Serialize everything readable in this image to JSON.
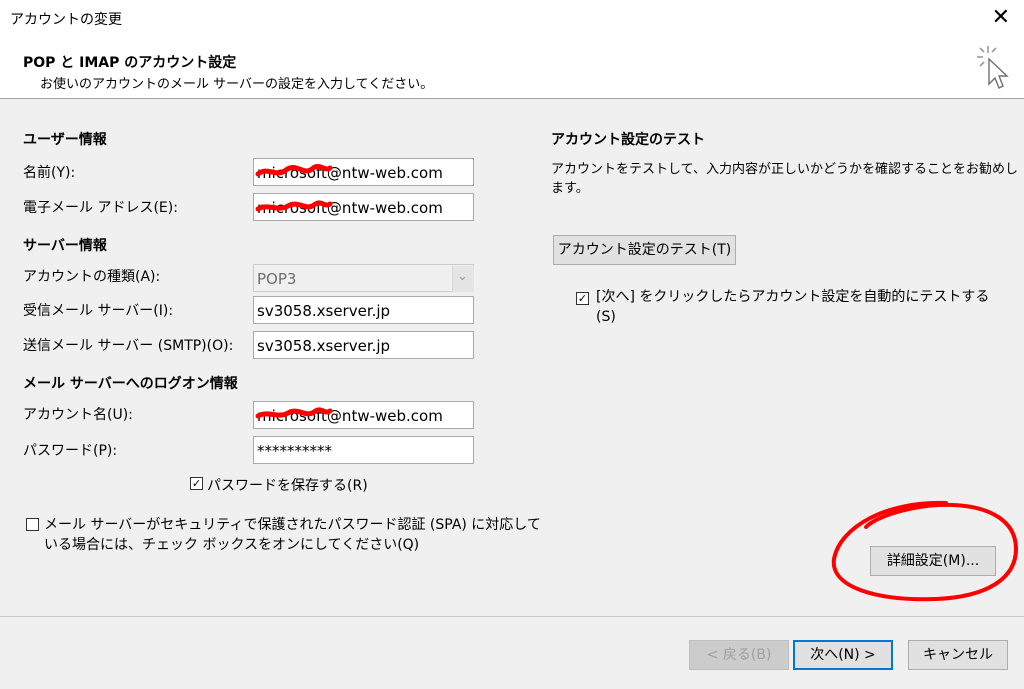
{
  "dialog": {
    "title": "アカウントの変更",
    "close_glyph": "✕",
    "header_title": "POP と IMAP のアカウント設定",
    "header_subtitle": "お使いのアカウントのメール サーバーの設定を入力してください。",
    "header_icon": "wizard-cursor-icon"
  },
  "user_info": {
    "heading": "ユーザー情報",
    "name_label": "名前(Y):",
    "name_value": "microsoft@ntw-web.com",
    "email_label": "電子メール アドレス(E):",
    "email_value": "microsoft@ntw-web.com"
  },
  "server_info": {
    "heading": "サーバー情報",
    "account_type_label": "アカウントの種類(A):",
    "account_type_value": "POP3",
    "incoming_label": "受信メール サーバー(I):",
    "incoming_value": "sv3058.xserver.jp",
    "outgoing_label": "送信メール サーバー (SMTP)(O):",
    "outgoing_value": "sv3058.xserver.jp"
  },
  "logon_info": {
    "heading": "メール サーバーへのログオン情報",
    "account_name_label": "アカウント名(U):",
    "account_name_value": "microsoft@ntw-web.com",
    "password_label": "パスワード(P):",
    "password_value": "**********",
    "save_password_label": "パスワードを保存する(R)",
    "save_password_checked": true,
    "spa_label_line1": "メール サーバーがセキュリティで保護されたパスワード認証 (SPA) に対応して",
    "spa_label_line2": "いる場合には、チェック ボックスをオンにしてください(Q)",
    "spa_checked": false
  },
  "test": {
    "heading": "アカウント設定のテスト",
    "desc_line1": "アカウントをテストして、入力内容が正しいかどうかを確認することをお勧めし",
    "desc_line2": "ます。",
    "test_button": "アカウント設定のテスト(T)",
    "auto_test_line1": "[次へ] をクリックしたらアカウント設定を自動的にテストする",
    "auto_test_line2": "(S)",
    "auto_test_checked": true
  },
  "advanced_button": "詳細設定(M)...",
  "footer": {
    "back": "< 戻る(B)",
    "next": "次へ(N) >",
    "cancel": "キャンセル"
  },
  "colors": {
    "annotation_red": "#ff0000",
    "focus_blue": "#0078d7"
  },
  "glyphs": {
    "check": "✓",
    "dropdown_arrow": "⌄"
  }
}
